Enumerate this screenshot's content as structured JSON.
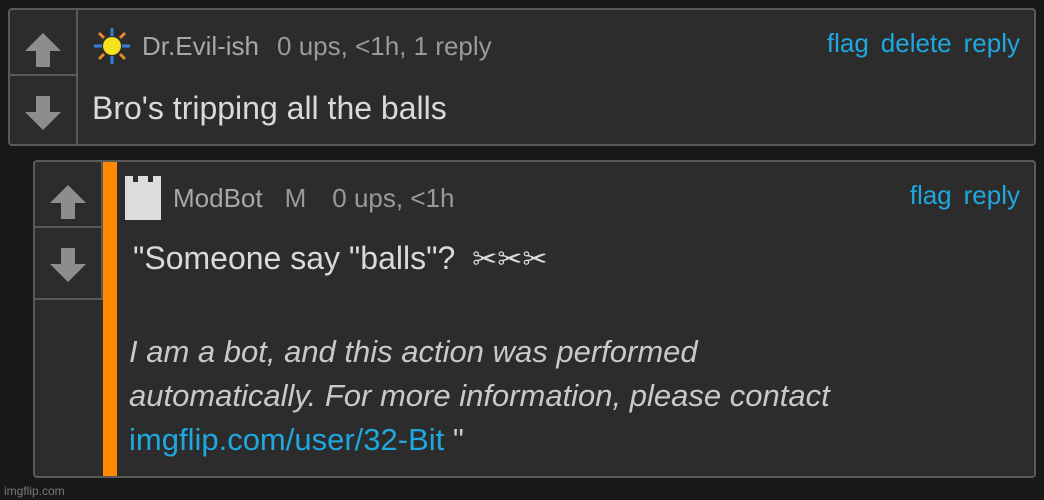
{
  "comment1": {
    "username": "Dr.Evil-ish",
    "meta": "0 ups, <1h, 1 reply",
    "actions": [
      "flag",
      "delete",
      "reply"
    ],
    "text": "Bro's tripping all the balls",
    "avatar_icon": "sun-icon"
  },
  "comment2": {
    "username": "ModBot",
    "mod_badge": "M",
    "meta": "0 ups, <1h",
    "actions": [
      "flag",
      "reply"
    ],
    "text": "\"Someone say \"balls\"?",
    "scissors": "✂✂✂",
    "bot_line1": "I am a bot, and this action was performed",
    "bot_line2": "automatically. For more information, please contact",
    "link": "imgflip.com/user/32-Bit",
    "quote_close": " \"",
    "avatar_icon": "tower-icon",
    "accent_color": "#ff8a00"
  },
  "footer": "imgflip.com",
  "colors": {
    "link": "#1fa8df",
    "background": "#181818",
    "panel": "#2c2c2c"
  }
}
